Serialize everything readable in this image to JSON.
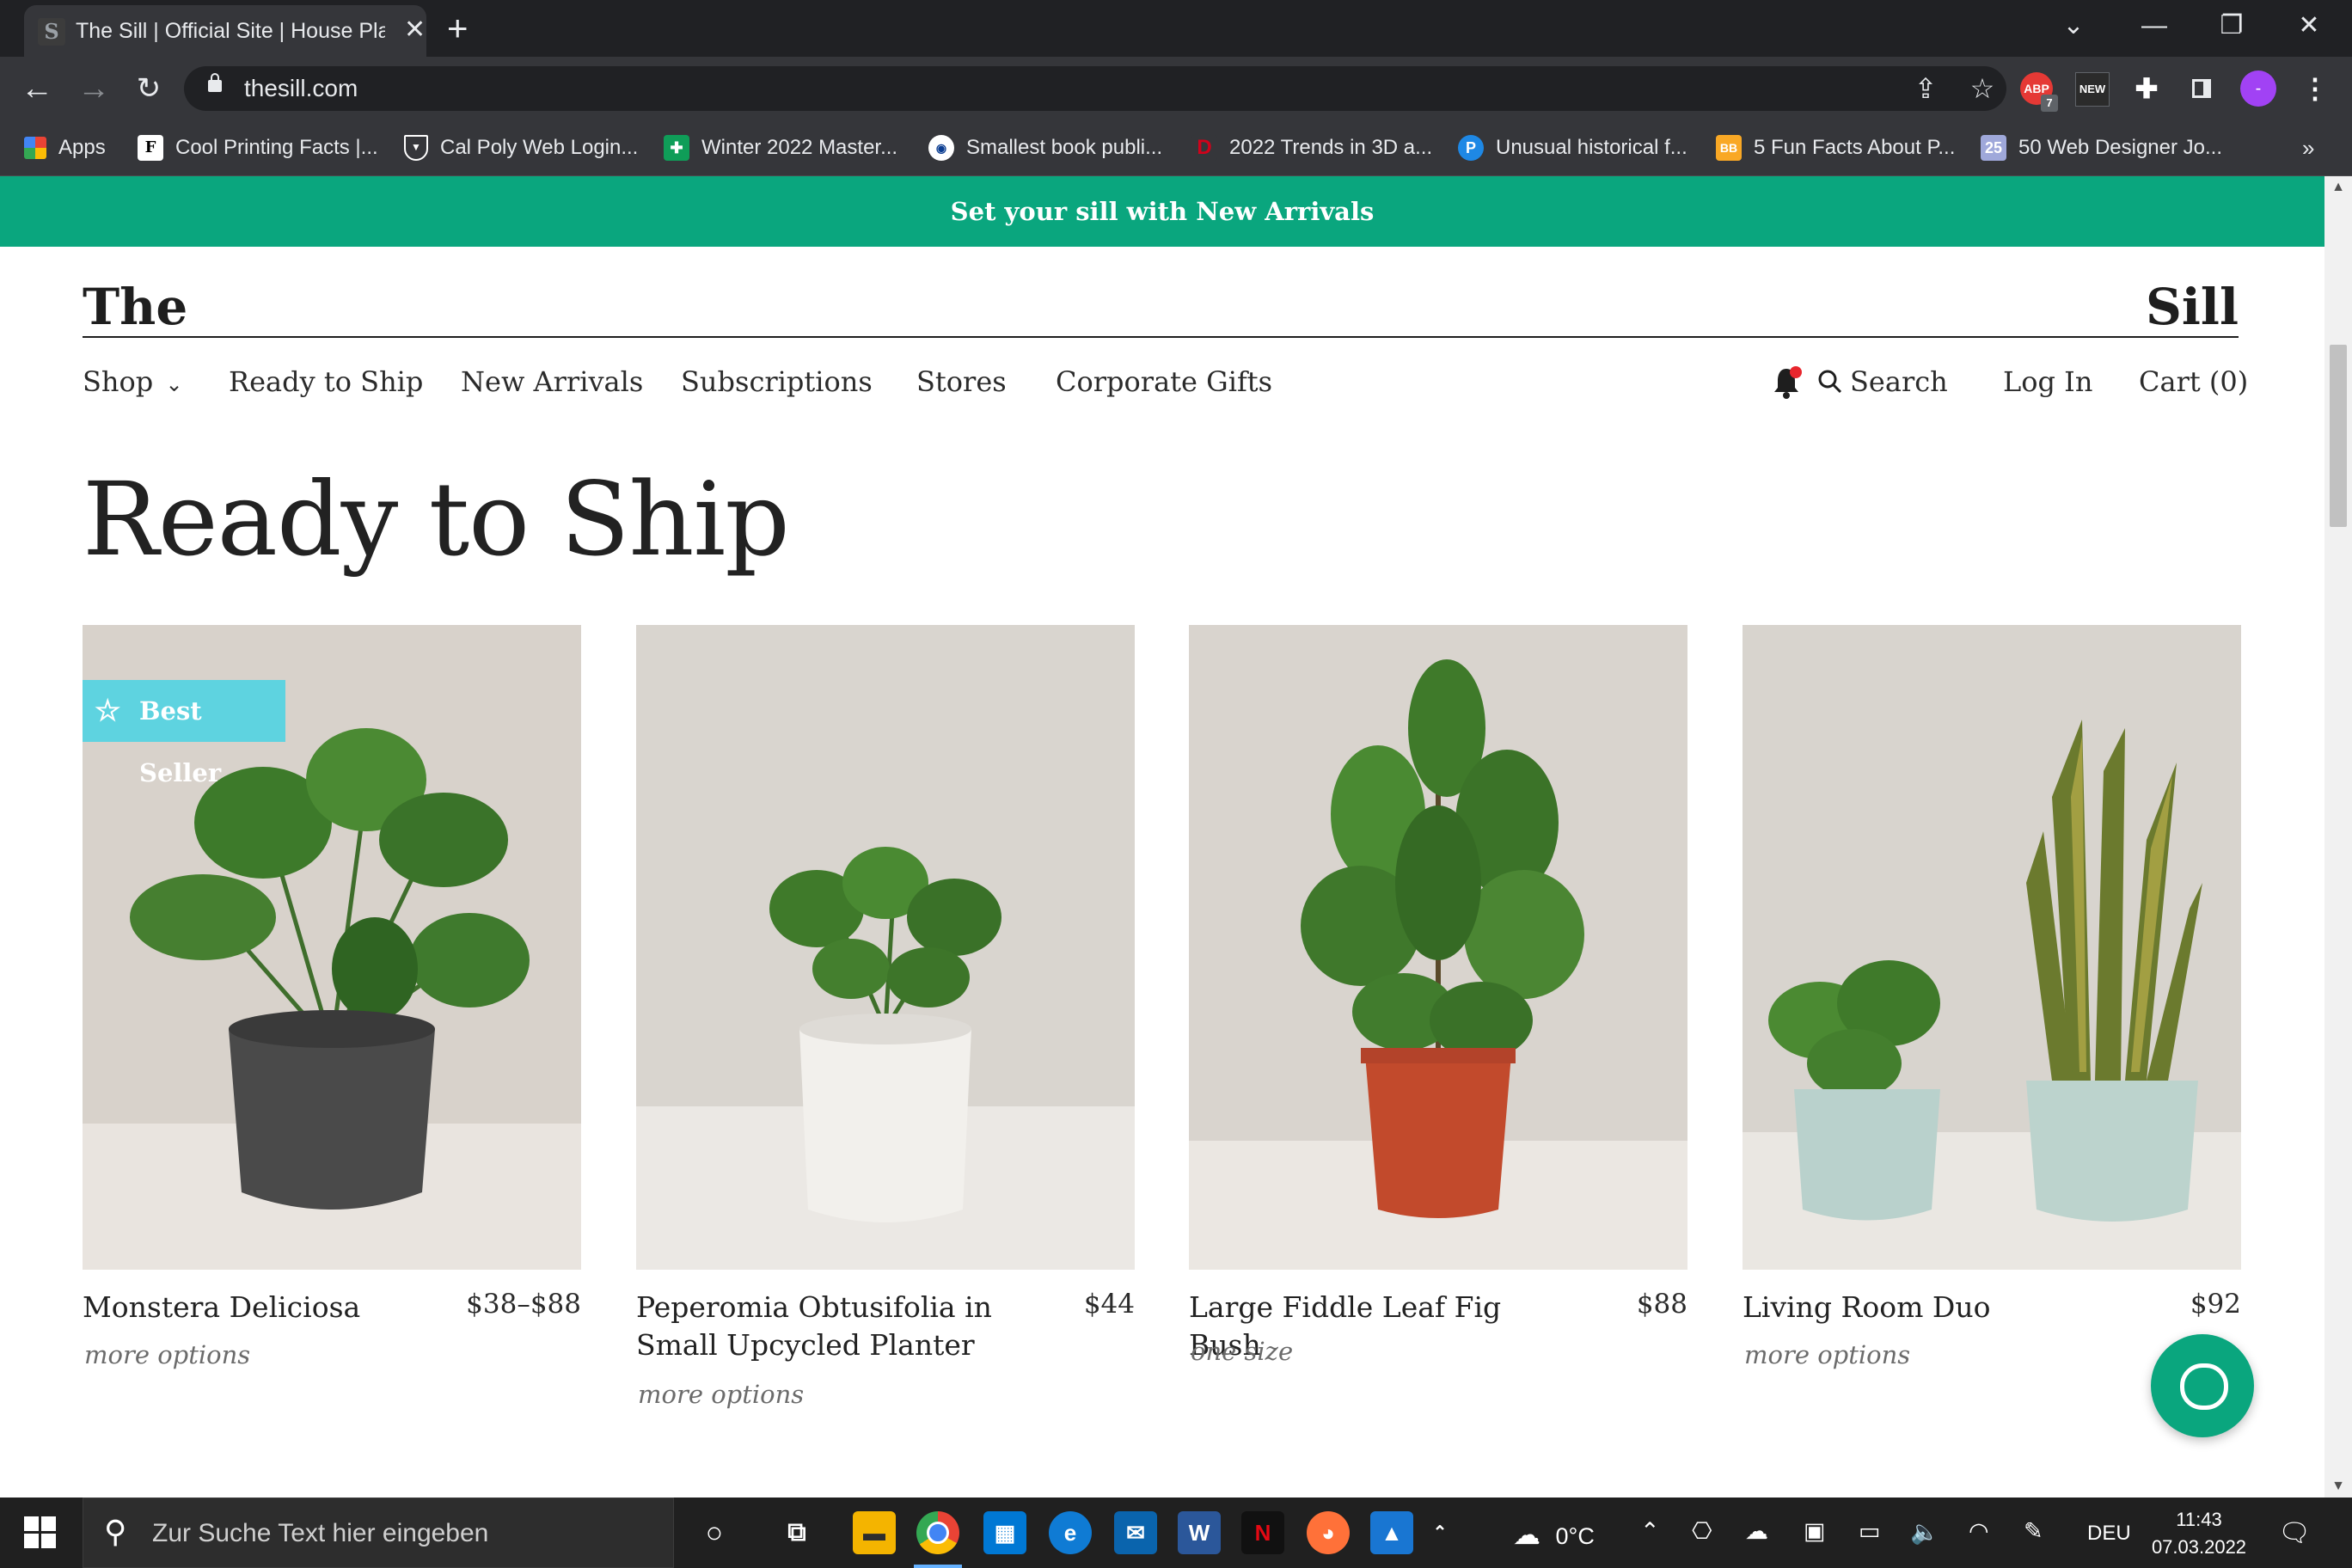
{
  "browser": {
    "tab_title": "The Sill | Official Site | House Plan",
    "tab_favicon": "S",
    "url": "thesill.com",
    "extensions": [
      {
        "icon": "adblock-icon",
        "label": "ABP",
        "badge": "7",
        "color": "#e53935"
      },
      {
        "icon": "new-extension-icon",
        "label": "NEW",
        "color": "#1a73e8"
      }
    ],
    "profile_initial": "-"
  },
  "bookmarks": [
    {
      "label": "Apps",
      "icon": "apps-grid-icon"
    },
    {
      "label": "Cool Printing Facts |...",
      "icon": "f-logo-icon"
    },
    {
      "label": "Cal Poly Web Login...",
      "icon": "shield-logo-icon"
    },
    {
      "label": "Winter 2022 Master...",
      "icon": "sheets-icon"
    },
    {
      "label": "Smallest book publi...",
      "icon": "guinness-icon"
    },
    {
      "label": "2022 Trends in 3D a...",
      "icon": "d-logo-icon"
    },
    {
      "label": "Unusual historical f...",
      "icon": "p-logo-icon"
    },
    {
      "label": "5 Fun Facts About P...",
      "icon": "bb-logo-icon"
    },
    {
      "label": "50 Web Designer Jo...",
      "icon": "25-logo-icon"
    }
  ],
  "site": {
    "announcement": "Set your sill with New Arrivals",
    "brand_left": "The",
    "brand_right": "Sill",
    "nav": [
      "Shop",
      "Ready to Ship",
      "New Arrivals",
      "Subscriptions",
      "Stores",
      "Corporate Gifts"
    ],
    "search_label": "Search",
    "login_label": "Log In",
    "cart_label": "Cart (0)",
    "page_title": "Ready to Ship",
    "badge_label": "Best Seller",
    "products": [
      {
        "name": "Monstera Deliciosa",
        "price": "$38–$88",
        "sub": "more options"
      },
      {
        "name": "Peperomia Obtusifolia in Small Upcycled Planter",
        "price": "$44",
        "sub": "more options"
      },
      {
        "name": "Large Fiddle Leaf Fig Bush",
        "price": "$88",
        "sub": "one size"
      },
      {
        "name": "Living Room Duo",
        "price": "$92",
        "sub": "more options"
      }
    ]
  },
  "taskbar": {
    "search_placeholder": "Zur Suche Text hier eingeben",
    "weather": "0°C",
    "language": "DEU",
    "time": "11:43",
    "date": "07.03.2022"
  },
  "colors": {
    "accent_green": "#0aa67e",
    "badge_cyan": "#5ed3e0",
    "notification_red": "#e8262d"
  }
}
